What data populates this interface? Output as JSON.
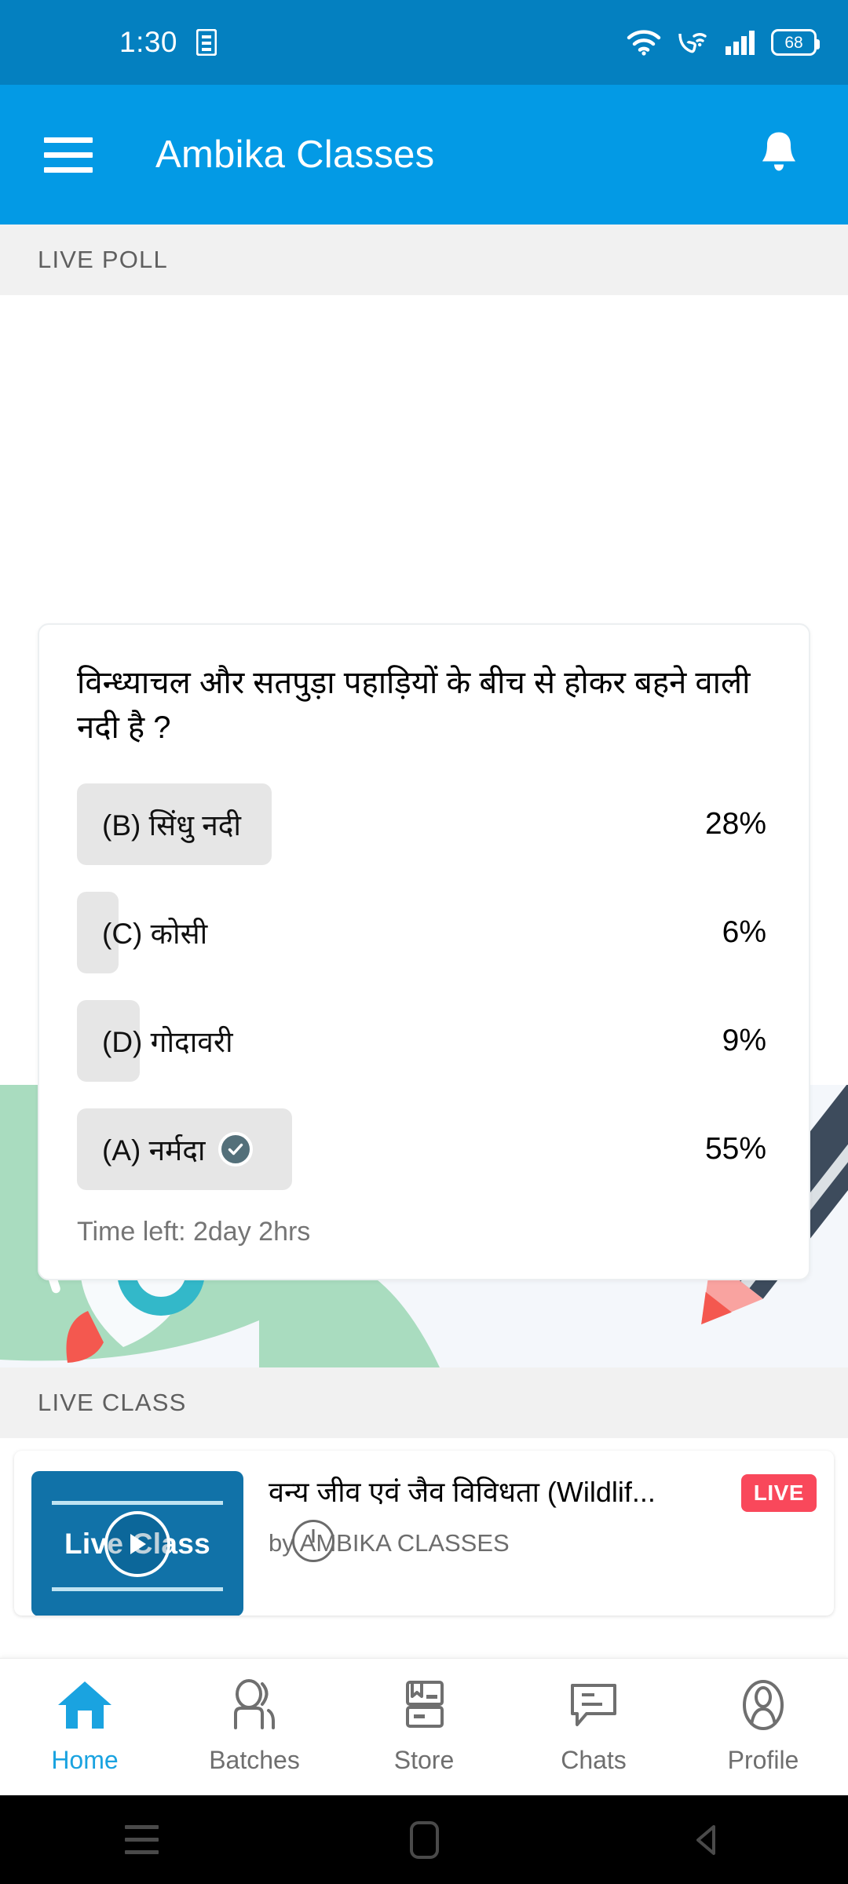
{
  "status_bar": {
    "time": "1:30",
    "battery_level": "68",
    "icons": [
      "sim-card-icon",
      "wifi-icon",
      "call-wifi-icon",
      "signal-icon",
      "battery-icon"
    ]
  },
  "app_bar": {
    "menu_icon": "hamburger-menu-icon",
    "title": "Ambika Classes",
    "notification_icon": "bell-icon"
  },
  "poll_section": {
    "header": "LIVE POLL",
    "question": "विन्ध्याचल और सतपुड़ा पहाड़ियों के बीच से होकर बहने वाली नदी है ?",
    "time_left": "Time left: 2day 2hrs",
    "selected_option_index": 3,
    "check_icon": "check-circle-icon",
    "options": [
      {
        "label": "(B) सिंधु नदी",
        "percent": "28%",
        "value": 28,
        "selected": false
      },
      {
        "label": "(C) कोसी",
        "percent": "6%",
        "value": 6,
        "selected": false
      },
      {
        "label": "(D) गोदावरी",
        "percent": "9%",
        "value": 9,
        "selected": false
      },
      {
        "label": "(A) नर्मदा",
        "percent": "55%",
        "value": 55,
        "selected": true
      }
    ]
  },
  "live_class_section": {
    "header": "LIVE CLASS",
    "thumbnail_text": "Live Class",
    "play_icon": "play-circle-icon",
    "title": "वन्य जीव एवं जैव विविधता (Wildlif...",
    "badge": "LIVE",
    "author": "by AMBIKA CLASSES",
    "clock_icon": "clock-icon"
  },
  "bottom_nav": {
    "items": [
      {
        "label": "Home",
        "icon": "home-icon",
        "active": true
      },
      {
        "label": "Batches",
        "icon": "people-icon",
        "active": false
      },
      {
        "label": "Store",
        "icon": "books-icon",
        "active": false
      },
      {
        "label": "Chats",
        "icon": "chat-icon",
        "active": false
      },
      {
        "label": "Profile",
        "icon": "person-icon",
        "active": false
      }
    ]
  },
  "system_nav": {
    "recents_icon": "recents-icon",
    "home_icon": "home-square-icon",
    "back_icon": "back-triangle-icon"
  },
  "colors": {
    "status_bar": "#0480c0",
    "app_bar": "#039ae5",
    "accent": "#1aa3e0",
    "live_badge": "#f9485b",
    "poll_bar": "#e6e6e6",
    "check_badge": "#54707a",
    "section_bg": "#f1f1f1"
  }
}
